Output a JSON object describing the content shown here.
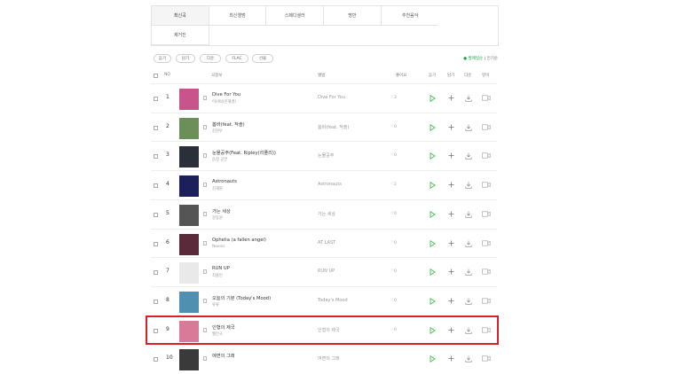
{
  "tabs": {
    "row1": [
      "최신곡",
      "최신앨범",
      "스페디셜러",
      "명반",
      "추천음악"
    ],
    "row2": [
      "제거진"
    ]
  },
  "toolbar": {
    "buttons": [
      "듣기",
      "담기",
      "다운",
      "FLAC",
      "선물"
    ],
    "sort_active": "● 발매일순",
    "sort_sep": "|",
    "sort_other": "인기순"
  },
  "header": {
    "no": "NO",
    "title": "곡정보",
    "album": "앨범",
    "like": "좋아요",
    "play": "듣기",
    "add": "담기",
    "download": "다운",
    "video": "뮤비"
  },
  "songs": [
    {
      "rank": "1",
      "title": "Dive For You",
      "artist": "이비비(민해경)",
      "album": "Dive For You",
      "likes": "♡3",
      "cover": "#c7558c"
    },
    {
      "rank": "2",
      "title": "봄바(feat. 작솔)",
      "artist": "김현우",
      "album": "봄바(feat. 작솔)",
      "likes": "♡0",
      "cover": "#6b8f58"
    },
    {
      "rank": "3",
      "title": "눈물공주(Feat. Ripley(리플리))",
      "artist": "음정 공연",
      "album": "눈물공주",
      "likes": "♡0",
      "cover": "#2a3038"
    },
    {
      "rank": "4",
      "title": "Astronauts",
      "artist": "김재원",
      "album": "Astronauts",
      "likes": "♡2",
      "cover": "#1b1f5a"
    },
    {
      "rank": "5",
      "title": "가는 세상",
      "artist": "강동원",
      "album": "가는 세상",
      "likes": "♡0",
      "cover": "#555555"
    },
    {
      "rank": "6",
      "title": "Ophelia (a fallen angel)",
      "artist": "Neonic",
      "album": "AT LAST",
      "likes": "♡0",
      "cover": "#5a2a3a"
    },
    {
      "rank": "7",
      "title": "RUN UP",
      "artist": "최홍인",
      "album": "RUN UP",
      "likes": "♡0",
      "cover": "#e9e9e9"
    },
    {
      "rank": "8",
      "title": "오늘의 기분 (Today's Mood)",
      "artist": "류류",
      "album": "Today's Mood",
      "likes": "♡0",
      "cover": "#4f8fb0"
    },
    {
      "rank": "9",
      "title": "인형의 제국",
      "artist": "웹안국",
      "album": "인형의 제국",
      "likes": "♡0",
      "cover": "#d97a98"
    },
    {
      "rank": "10",
      "title": "에면의 그래",
      "artist": "",
      "album": "여면의 그래",
      "likes": "",
      "cover": "#3a3a3a"
    }
  ]
}
